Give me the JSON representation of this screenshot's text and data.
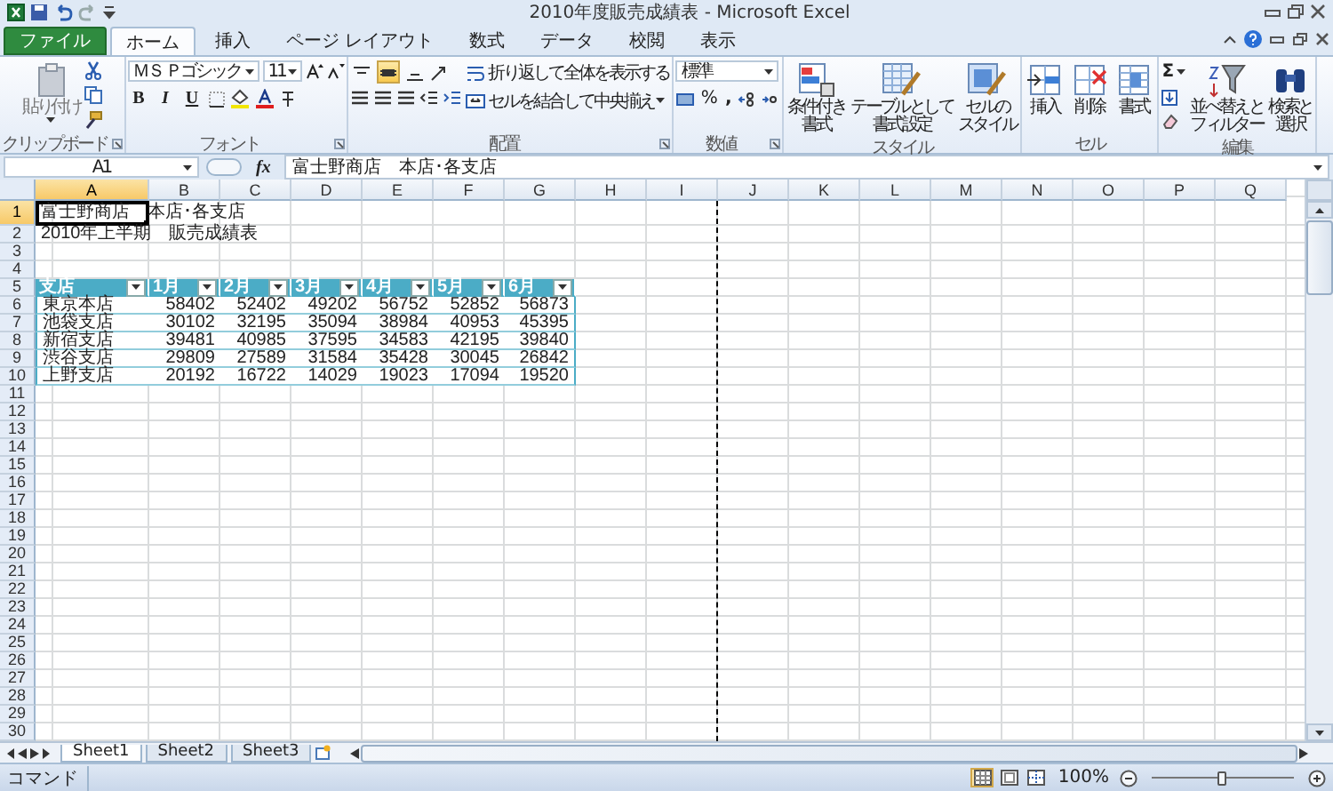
{
  "window": {
    "title": "2010年度販売成績表 - Microsoft Excel"
  },
  "tabs": [
    {
      "label": "ファイル",
      "kind": "file",
      "selected": false
    },
    {
      "label": "ホーム",
      "kind": "tab",
      "selected": true
    },
    {
      "label": "挿入",
      "kind": "tab",
      "selected": false
    },
    {
      "label": "ページ レイアウト",
      "kind": "tab",
      "selected": false
    },
    {
      "label": "数式",
      "kind": "tab",
      "selected": false
    },
    {
      "label": "データ",
      "kind": "tab",
      "selected": false
    },
    {
      "label": "校閲",
      "kind": "tab",
      "selected": false
    },
    {
      "label": "表示",
      "kind": "tab",
      "selected": false
    }
  ],
  "ribbon": {
    "clipboard": {
      "label": "クリップボード",
      "paste": "貼り付け"
    },
    "font": {
      "label": "フォント",
      "font_name": "ＭＳ Ｐゴシック",
      "font_size": "11",
      "bold": "B",
      "italic": "I",
      "underline": "U"
    },
    "alignment": {
      "label": "配置",
      "vertical_align": [
        {
          "selected": false
        },
        {
          "selected": true
        },
        {
          "selected": false
        }
      ],
      "wrap_text": "折り返して全体を表示する",
      "merge_center": "セルを結合して中央揃え"
    },
    "number": {
      "label": "数値",
      "format": "標準",
      "percent": "%",
      "comma": ","
    },
    "styles": {
      "label": "スタイル",
      "buttons": [
        {
          "lines": [
            "条件付き",
            "書式"
          ]
        },
        {
          "lines": [
            "テーブルとして",
            "書式設定"
          ]
        },
        {
          "lines": [
            "セルの",
            "スタイル"
          ]
        }
      ]
    },
    "cells": {
      "label": "セル",
      "buttons": [
        {
          "lines": [
            "挿入"
          ]
        },
        {
          "lines": [
            "削除"
          ]
        },
        {
          "lines": [
            "書式"
          ]
        }
      ]
    },
    "editing": {
      "label": "編集",
      "sum": "Σ",
      "buttons": [
        {
          "lines": [
            "並べ替えと",
            "フィルター"
          ]
        },
        {
          "lines": [
            "検索と",
            "選択"
          ]
        }
      ]
    }
  },
  "name_box": {
    "value": "A1"
  },
  "formula_bar": {
    "function_label": "fx",
    "value": "富士野商店　本店･各支店"
  },
  "sheet": {
    "columns": [
      {
        "label": "A",
        "selected": true,
        "page_break": false
      },
      {
        "label": "B",
        "selected": false,
        "page_break": false
      },
      {
        "label": "C",
        "selected": false,
        "page_break": false
      },
      {
        "label": "D",
        "selected": false,
        "page_break": false
      },
      {
        "label": "E",
        "selected": false,
        "page_break": false
      },
      {
        "label": "F",
        "selected": false,
        "page_break": false
      },
      {
        "label": "G",
        "selected": false,
        "page_break": false
      },
      {
        "label": "H",
        "selected": false,
        "page_break": false
      },
      {
        "label": "I",
        "selected": false,
        "page_break": true
      },
      {
        "label": "J",
        "selected": false,
        "page_break": false
      },
      {
        "label": "K",
        "selected": false,
        "page_break": false
      },
      {
        "label": "L",
        "selected": false,
        "page_break": false
      },
      {
        "label": "M",
        "selected": false,
        "page_break": false
      },
      {
        "label": "N",
        "selected": false,
        "page_break": false
      },
      {
        "label": "O",
        "selected": false,
        "page_break": false
      },
      {
        "label": "P",
        "selected": false,
        "page_break": false
      },
      {
        "label": "Q",
        "selected": false,
        "page_break": false
      }
    ],
    "rows": [
      {
        "label": "1",
        "selected": true,
        "kind": "text",
        "cells": [
          "富士野商店　本店･各支店"
        ]
      },
      {
        "label": "2",
        "selected": false,
        "kind": "text",
        "cells": [
          "2010年上半期　販売成績表"
        ]
      },
      {
        "label": "3",
        "selected": false
      },
      {
        "label": "4",
        "selected": false
      },
      {
        "label": "5",
        "selected": false,
        "kind": "table_header",
        "cells": [
          "支店",
          "1月",
          "2月",
          "3月",
          "4月",
          "5月",
          "6月"
        ]
      },
      {
        "label": "6",
        "selected": false,
        "kind": "table_row",
        "cells": [
          "東京本店",
          "58402",
          "52402",
          "49202",
          "56752",
          "52852",
          "56873"
        ]
      },
      {
        "label": "7",
        "selected": false,
        "kind": "table_row",
        "cells": [
          "池袋支店",
          "30102",
          "32195",
          "35094",
          "38984",
          "40953",
          "45395"
        ]
      },
      {
        "label": "8",
        "selected": false,
        "kind": "table_row",
        "cells": [
          "新宿支店",
          "39481",
          "40985",
          "37595",
          "34583",
          "42195",
          "39840"
        ]
      },
      {
        "label": "9",
        "selected": false,
        "kind": "table_row",
        "cells": [
          "渋谷支店",
          "29809",
          "27589",
          "31584",
          "35428",
          "30045",
          "26842"
        ]
      },
      {
        "label": "10",
        "selected": false,
        "kind": "table_row",
        "cells": [
          "上野支店",
          "20192",
          "16722",
          "14029",
          "19023",
          "17094",
          "19520"
        ]
      },
      {
        "label": "11",
        "selected": false
      },
      {
        "label": "12",
        "selected": false
      },
      {
        "label": "13",
        "selected": false
      },
      {
        "label": "14",
        "selected": false
      },
      {
        "label": "15",
        "selected": false
      },
      {
        "label": "16",
        "selected": false
      },
      {
        "label": "17",
        "selected": false
      },
      {
        "label": "18",
        "selected": false
      },
      {
        "label": "19",
        "selected": false
      },
      {
        "label": "20",
        "selected": false
      },
      {
        "label": "21",
        "selected": false
      },
      {
        "label": "22",
        "selected": false
      },
      {
        "label": "23",
        "selected": false
      },
      {
        "label": "24",
        "selected": false
      },
      {
        "label": "25",
        "selected": false
      },
      {
        "label": "26",
        "selected": false
      },
      {
        "label": "27",
        "selected": false
      },
      {
        "label": "28",
        "selected": false
      },
      {
        "label": "29",
        "selected": false
      },
      {
        "label": "30",
        "selected": false
      }
    ]
  },
  "sheet_tabs": [
    {
      "label": "Sheet1",
      "selected": true
    },
    {
      "label": "Sheet2",
      "selected": false
    },
    {
      "label": "Sheet3",
      "selected": false
    }
  ],
  "status_bar": {
    "mode": "コマンド",
    "views": [
      {
        "selected": true
      },
      {
        "selected": false
      },
      {
        "selected": false
      }
    ],
    "zoom": "100%",
    "zoom_slider": {
      "level": 0.5
    }
  }
}
